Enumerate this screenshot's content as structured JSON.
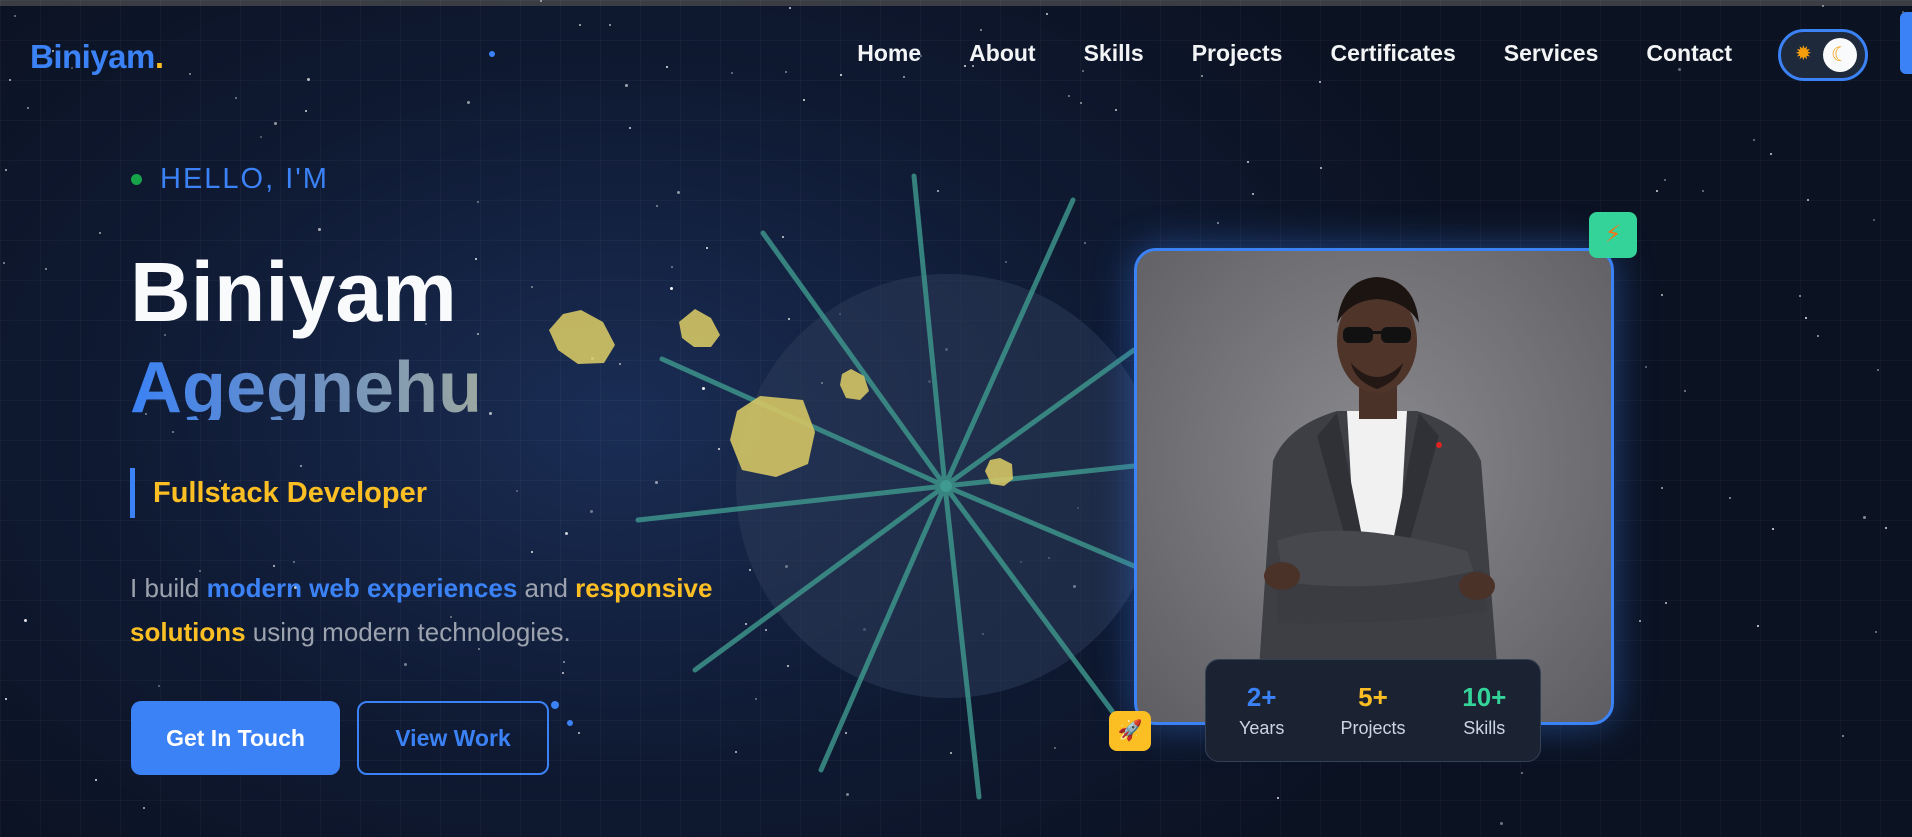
{
  "brand": {
    "name": "Biniyam",
    "dot": "."
  },
  "nav": {
    "links": [
      "Home",
      "About",
      "Skills",
      "Projects",
      "Certificates",
      "Services",
      "Contact"
    ],
    "theme_toggle": {
      "sun_icon": "sun-icon",
      "moon_icon": "moon-icon"
    }
  },
  "hero": {
    "greeting": "HELLO, I'M",
    "first_name": "Biniyam",
    "last_name": "Agegnehu",
    "role": "Fullstack Developer",
    "description": {
      "part1": "I build ",
      "highlight1": "modern web experiences",
      "part2": " and ",
      "highlight2": "responsive solutions",
      "part3": " using modern technologies."
    },
    "primary_button": "Get In Touch",
    "secondary_button": "View Work"
  },
  "profile": {
    "photo_alt": "Biniyam Agegnehu portrait",
    "top_badge_icon": "lightning-icon",
    "bottom_badge_icon": "rocket-icon",
    "stats": [
      {
        "value": "2+",
        "label": "Years",
        "color": "#3b82f6"
      },
      {
        "value": "5+",
        "label": "Projects",
        "color": "#fbbf24"
      },
      {
        "value": "10+",
        "label": "Skills",
        "color": "#34d399"
      }
    ]
  },
  "colors": {
    "accent": "#3b82f6",
    "highlight": "#fbbf24",
    "success": "#34d399",
    "background": "#0f1a33"
  }
}
